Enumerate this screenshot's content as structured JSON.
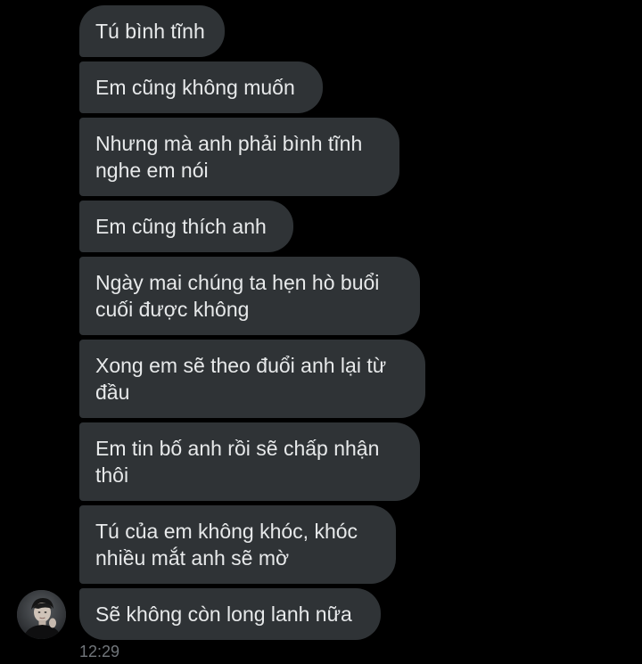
{
  "messages": [
    {
      "text": "Tú bình tĩnh"
    },
    {
      "text": "Em cũng không muốn"
    },
    {
      "text": "Nhưng mà anh phải bình tĩnh\nnghe em nói"
    },
    {
      "text": "Em cũng thích anh"
    },
    {
      "text": "Ngày mai chúng ta hẹn hò buổi\ncuối được không"
    },
    {
      "text": "Xong em sẽ theo đuổi anh lại từ\nđầu"
    },
    {
      "text": "Em tin bố anh rồi sẽ chấp nhận\nthôi"
    },
    {
      "text": "Tú của em không khóc, khóc\nnhiều mắt anh sẽ mờ"
    },
    {
      "text": "Sẽ không còn long lanh nữa"
    }
  ],
  "timestamp": "12:29",
  "colors": {
    "background": "#000000",
    "bubble": "#2f3336",
    "bubble_text": "#e7e9ea",
    "timestamp": "#71767b"
  },
  "avatar": {
    "icon": "user-avatar"
  }
}
